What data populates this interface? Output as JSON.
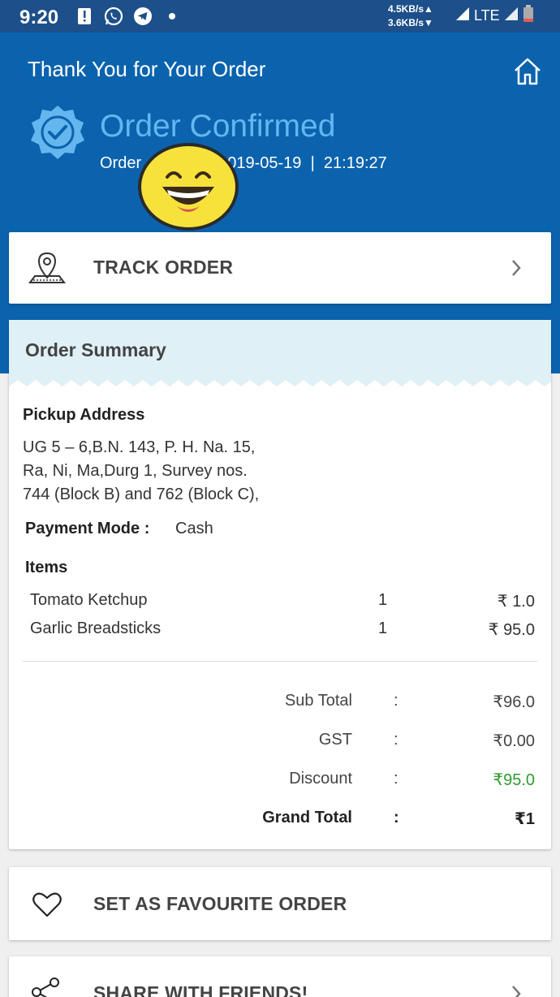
{
  "status_bar": {
    "time": "9:20",
    "speed_up": "4.5KB/s▲",
    "speed_down": "3.6KB/s▼",
    "network": "LTE",
    "icons": [
      "alert-icon",
      "whatsapp-icon",
      "telegram-icon",
      "dot-icon",
      "signal-icon",
      "battery-icon"
    ]
  },
  "header": {
    "title": "Thank You for Your Order",
    "confirmed": "Order Confirmed",
    "order_prefix": "Order",
    "date": "2019-05-19",
    "separator": "|",
    "time": "21:19:27"
  },
  "track": {
    "label": "TRACK ORDER"
  },
  "summary": {
    "title": "Order Summary",
    "pickup_label": "Pickup Address",
    "address_lines": [
      "UG 5 – 6,B.N. 143, P. H. Na. 15,",
      "Ra, Ni, Ma,Durg 1, Survey nos.",
      "744 (Block B) and 762 (Block C),"
    ],
    "payment_label": "Payment Mode :",
    "payment_value": "Cash",
    "items_label": "Items",
    "items": [
      {
        "name": "Tomato Ketchup",
        "qty": "1",
        "price": "₹ 1.0"
      },
      {
        "name": "Garlic Breadsticks",
        "qty": "1",
        "price": "₹ 95.0"
      }
    ],
    "totals": [
      {
        "label": "Sub Total",
        "colon": ":",
        "value": "₹96.0"
      },
      {
        "label": "GST",
        "colon": ":",
        "value": "₹0.00"
      },
      {
        "label": "Discount",
        "colon": ":",
        "value": "₹95.0"
      },
      {
        "label": "Grand Total",
        "colon": ":",
        "value": "₹1"
      }
    ]
  },
  "favourite": {
    "label": "SET AS FAVOURITE ORDER"
  },
  "share": {
    "label": "SHARE WITH FRIENDS!"
  },
  "colors": {
    "header_bg": "#0b63ae",
    "status_bg": "#1d4f8a",
    "accent_light_blue": "#64b6ef",
    "discount_green": "#2e9b2e",
    "summary_head_bg": "#dff0f6"
  }
}
